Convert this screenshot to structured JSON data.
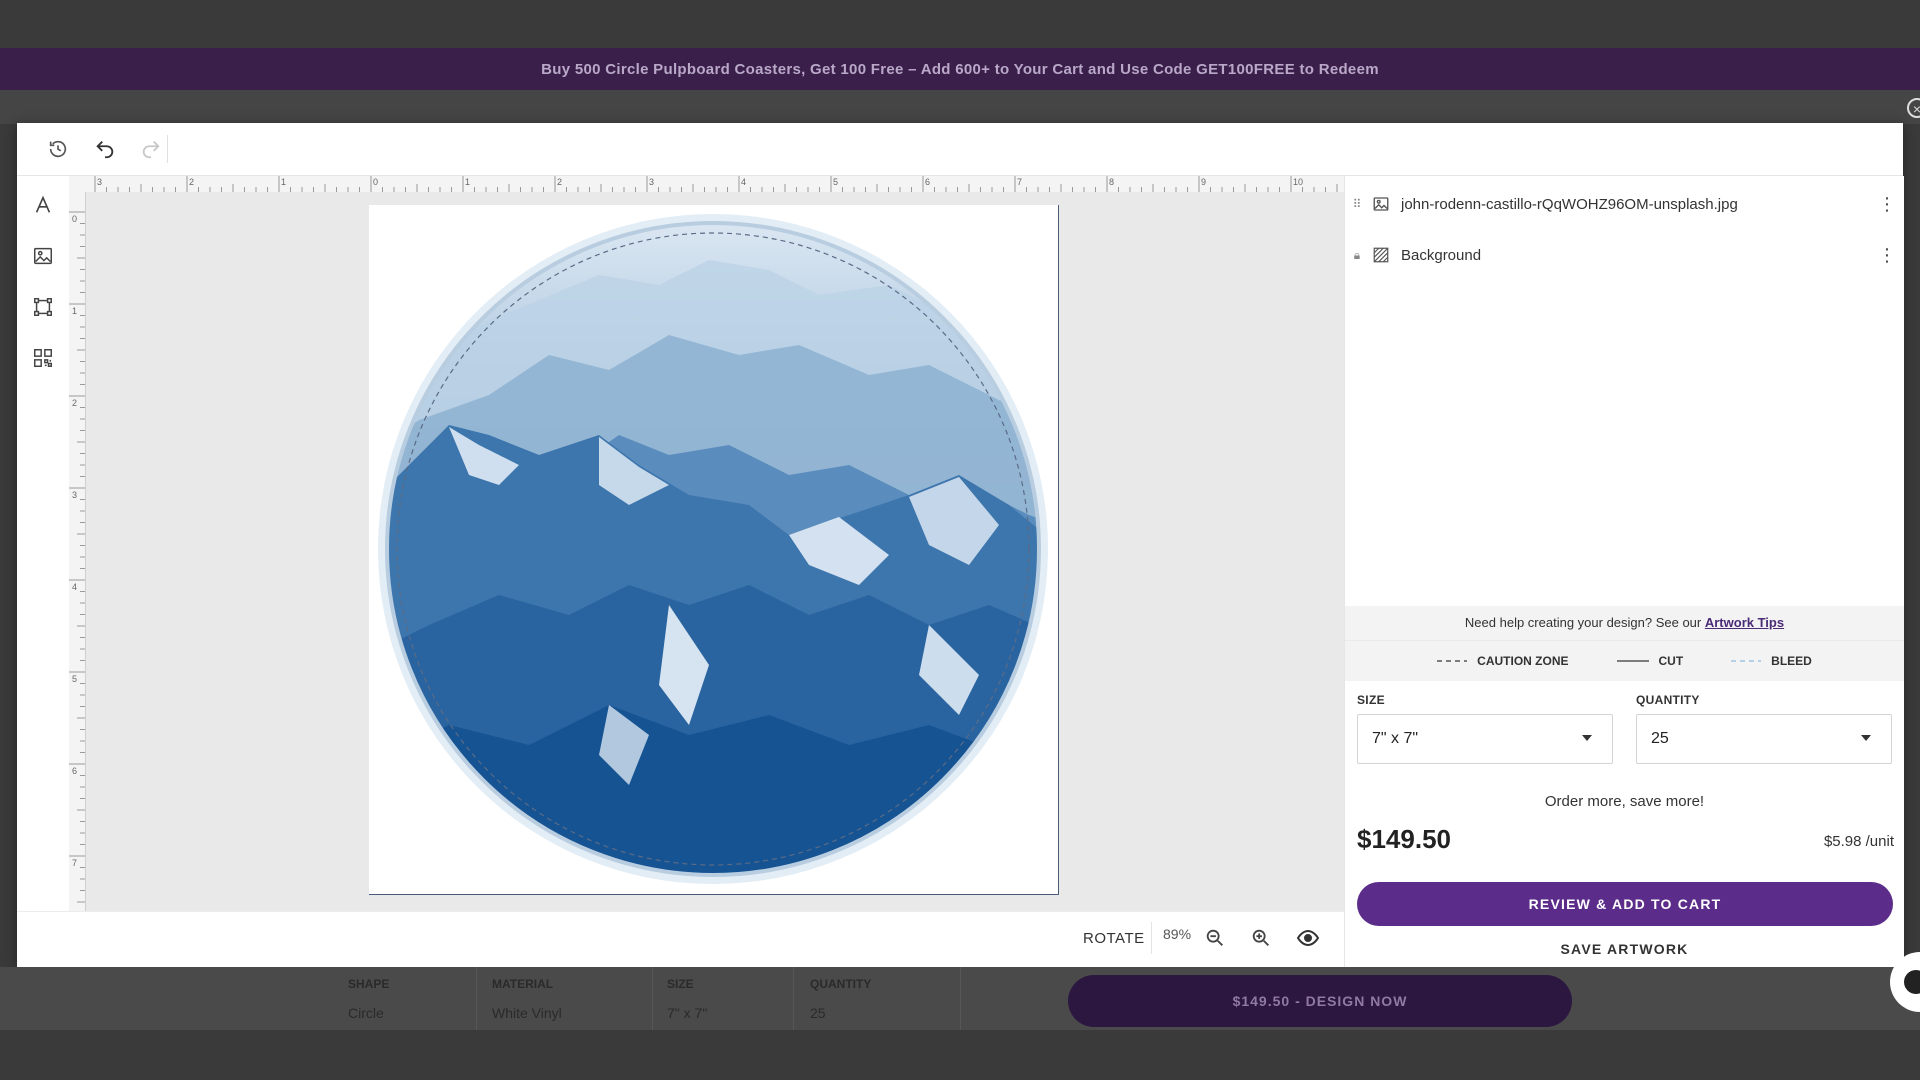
{
  "promo": {
    "text": "Buy 500 Circle Pulpboard Coasters, Get 100 Free – Add 600+ to Your Cart and Use Code GET100FREE to Redeem"
  },
  "toolbar": {
    "icons": [
      "history-icon",
      "undo-icon",
      "redo-icon"
    ],
    "tools": [
      "text-tool-icon",
      "image-tool-icon",
      "shape-tool-icon",
      "qr-code-tool-icon"
    ]
  },
  "rulers": {
    "top_labels": [
      "3",
      "2",
      "1",
      "0",
      "1",
      "2",
      "3",
      "4",
      "5",
      "6",
      "7",
      "8",
      "9",
      "10"
    ],
    "left_labels": [
      "0",
      "1",
      "2",
      "3",
      "4",
      "5",
      "6",
      "7"
    ]
  },
  "canvas": {
    "bottom": {
      "rotate_label": "ROTATE",
      "zoom_value": "89%"
    }
  },
  "layers": [
    {
      "name": "john-rodenn-castillo-rQqWOHZ96OM-unsplash.jpg",
      "icon": "image-layer-icon"
    },
    {
      "name": "Background",
      "icon": "background-layer-icon"
    }
  ],
  "help": {
    "prefix": "Need help creating your design? See our ",
    "link": "Artwork Tips"
  },
  "legend": {
    "caution": "CAUTION ZONE",
    "cut": "CUT",
    "bleed": "BLEED"
  },
  "order": {
    "size_label": "SIZE",
    "size_value": "7\" x 7\"",
    "quantity_label": "QUANTITY",
    "quantity_value": "25",
    "save_more": "Order more, save more!",
    "price": "$149.50",
    "unit_price": "$5.98 /unit",
    "cart_button": "REVIEW & ADD TO CART",
    "save_button": "SAVE ARTWORK"
  },
  "summary": {
    "columns": [
      {
        "header": "SHAPE",
        "value": "Circle"
      },
      {
        "header": "MATERIAL",
        "value": "White Vinyl"
      },
      {
        "header": "SIZE",
        "value": "7\" x 7\""
      },
      {
        "header": "QUANTITY",
        "value": "25"
      }
    ],
    "design_now": "$149.50 - DESIGN NOW"
  },
  "colors": {
    "accent": "#5b2c8a",
    "promo_bg": "#3a1f4a"
  }
}
